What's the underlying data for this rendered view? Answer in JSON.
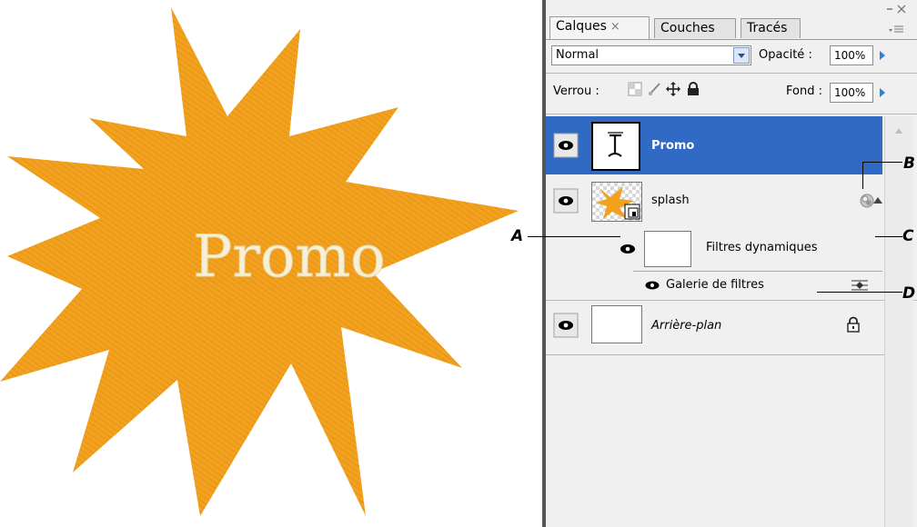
{
  "artwork": {
    "text": "Promo",
    "fill_color": "#f2a11f",
    "text_color": "#f7efd6"
  },
  "panel": {
    "tabs": [
      {
        "label": "Calques",
        "close": "×",
        "active": true
      },
      {
        "label": "Couches",
        "active": false
      },
      {
        "label": "Tracés",
        "active": false
      }
    ],
    "panel_menu_icon": "panel-menu-icon",
    "blend_mode": "Normal",
    "opacity_label": "Opacité :",
    "opacity_value": "100%",
    "lock_label": "Verrou :",
    "lock_icons": [
      "lock-transparency-icon",
      "lock-paint-icon",
      "lock-position-icon",
      "lock-all-icon"
    ],
    "fill_label": "Fond :",
    "fill_value": "100%",
    "layers": [
      {
        "name": "Promo",
        "type": "text",
        "selected": true
      },
      {
        "name": "splash",
        "type": "smart-object",
        "badge": "smart-filter-icon",
        "expand": "collapse-arrow-icon"
      },
      {
        "name": "Filtres dynamiques",
        "type": "smart-filters-mask"
      },
      {
        "name": "Galerie de filtres",
        "type": "filter",
        "options_icon": "filter-blending-options-icon"
      },
      {
        "name": "Arrière-plan",
        "type": "background",
        "locked": true
      }
    ],
    "selection_color": "#316ac5"
  },
  "callouts": [
    "A",
    "B",
    "C",
    "D"
  ]
}
